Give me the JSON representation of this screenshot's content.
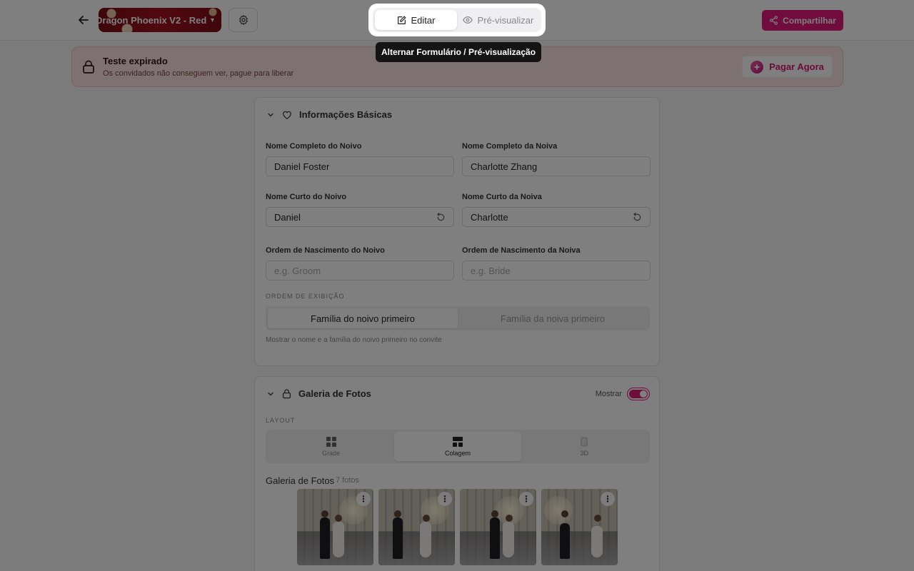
{
  "header": {
    "template_name": "Dragon Phoenix V2 - Red",
    "mode_edit": "Editar",
    "mode_preview": "Pré-visualizar",
    "tooltip": "Alternar Formulário / Pré-visualização",
    "share_label": "Compartilhar"
  },
  "banner": {
    "title": "Teste expirado",
    "subtitle": "Os convidados não conseguem ver, pague para liberar",
    "pay_label": "Pagar Agora"
  },
  "basic": {
    "title": "Informações Básicas",
    "groom_full_label": "Nome Completo do Noivo",
    "groom_full_value": "Daniel Foster",
    "bride_full_label": "Nome Completo da Noiva",
    "bride_full_value": "Charlotte Zhang",
    "groom_short_label": "Nome Curto do Noivo",
    "groom_short_value": "Daniel",
    "bride_short_label": "Nome Curto da Noiva",
    "bride_short_value": "Charlotte",
    "groom_order_label": "Ordem de Nascimento do Noivo",
    "groom_order_placeholder": "e.g. Groom",
    "bride_order_label": "Ordem de Nascimento da Noiva",
    "bride_order_placeholder": "e.g. Bride",
    "display_order_label": "ORDEM DE EXIBIÇÃO",
    "order_groom_first": "Família do noivo primeiro",
    "order_bride_first": "Família da noiva primeiro",
    "order_hint": "Mostrar o nome e a família do noivo primeiro no convite"
  },
  "gallery": {
    "title": "Galeria de Fotos",
    "show_label": "Mostrar",
    "layout_label": "LAYOUT",
    "layout_grid": "Grade",
    "layout_collage": "Colagem",
    "layout_3d": "3D",
    "gallery_title": "Galeria de Fotos",
    "photo_count": "7 fotos",
    "menu_glyph": "⋮"
  },
  "colors": {
    "accent": "#e0197d",
    "banner_bg": "#fbe2e2"
  }
}
